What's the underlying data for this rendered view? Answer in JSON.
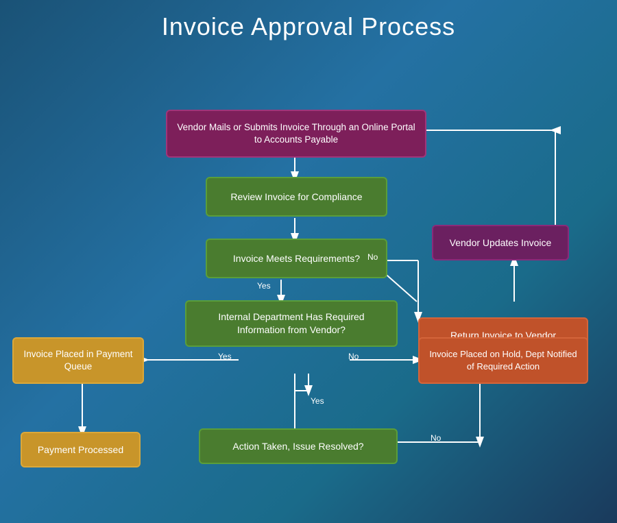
{
  "title": "Invoice Approval Process",
  "boxes": {
    "vendor_submit": {
      "label": "Vendor Mails or Submits Invoice Through an Online Portal to Accounts Payable",
      "color": "purple"
    },
    "review_compliance": {
      "label": "Review Invoice for Compliance",
      "color": "green"
    },
    "invoice_meets": {
      "label": "Invoice Meets Requirements?",
      "color": "green"
    },
    "internal_dept": {
      "label": "Internal Department Has Required Information from Vendor?",
      "color": "green"
    },
    "return_invoice": {
      "label": "Return Invoice to Vendor",
      "color": "orange"
    },
    "vendor_updates": {
      "label": "Vendor Updates Invoice",
      "color": "dark_purple"
    },
    "invoice_queue": {
      "label": "Invoice Placed in Payment Queue",
      "color": "yellow"
    },
    "invoice_hold": {
      "label": "Invoice Placed on Hold, Dept Notified of Required Action",
      "color": "orange"
    },
    "action_taken": {
      "label": "Action Taken, Issue Resolved?",
      "color": "green"
    },
    "payment_processed": {
      "label": "Payment Processed",
      "color": "yellow"
    }
  },
  "labels": {
    "yes": "Yes",
    "no": "No"
  }
}
